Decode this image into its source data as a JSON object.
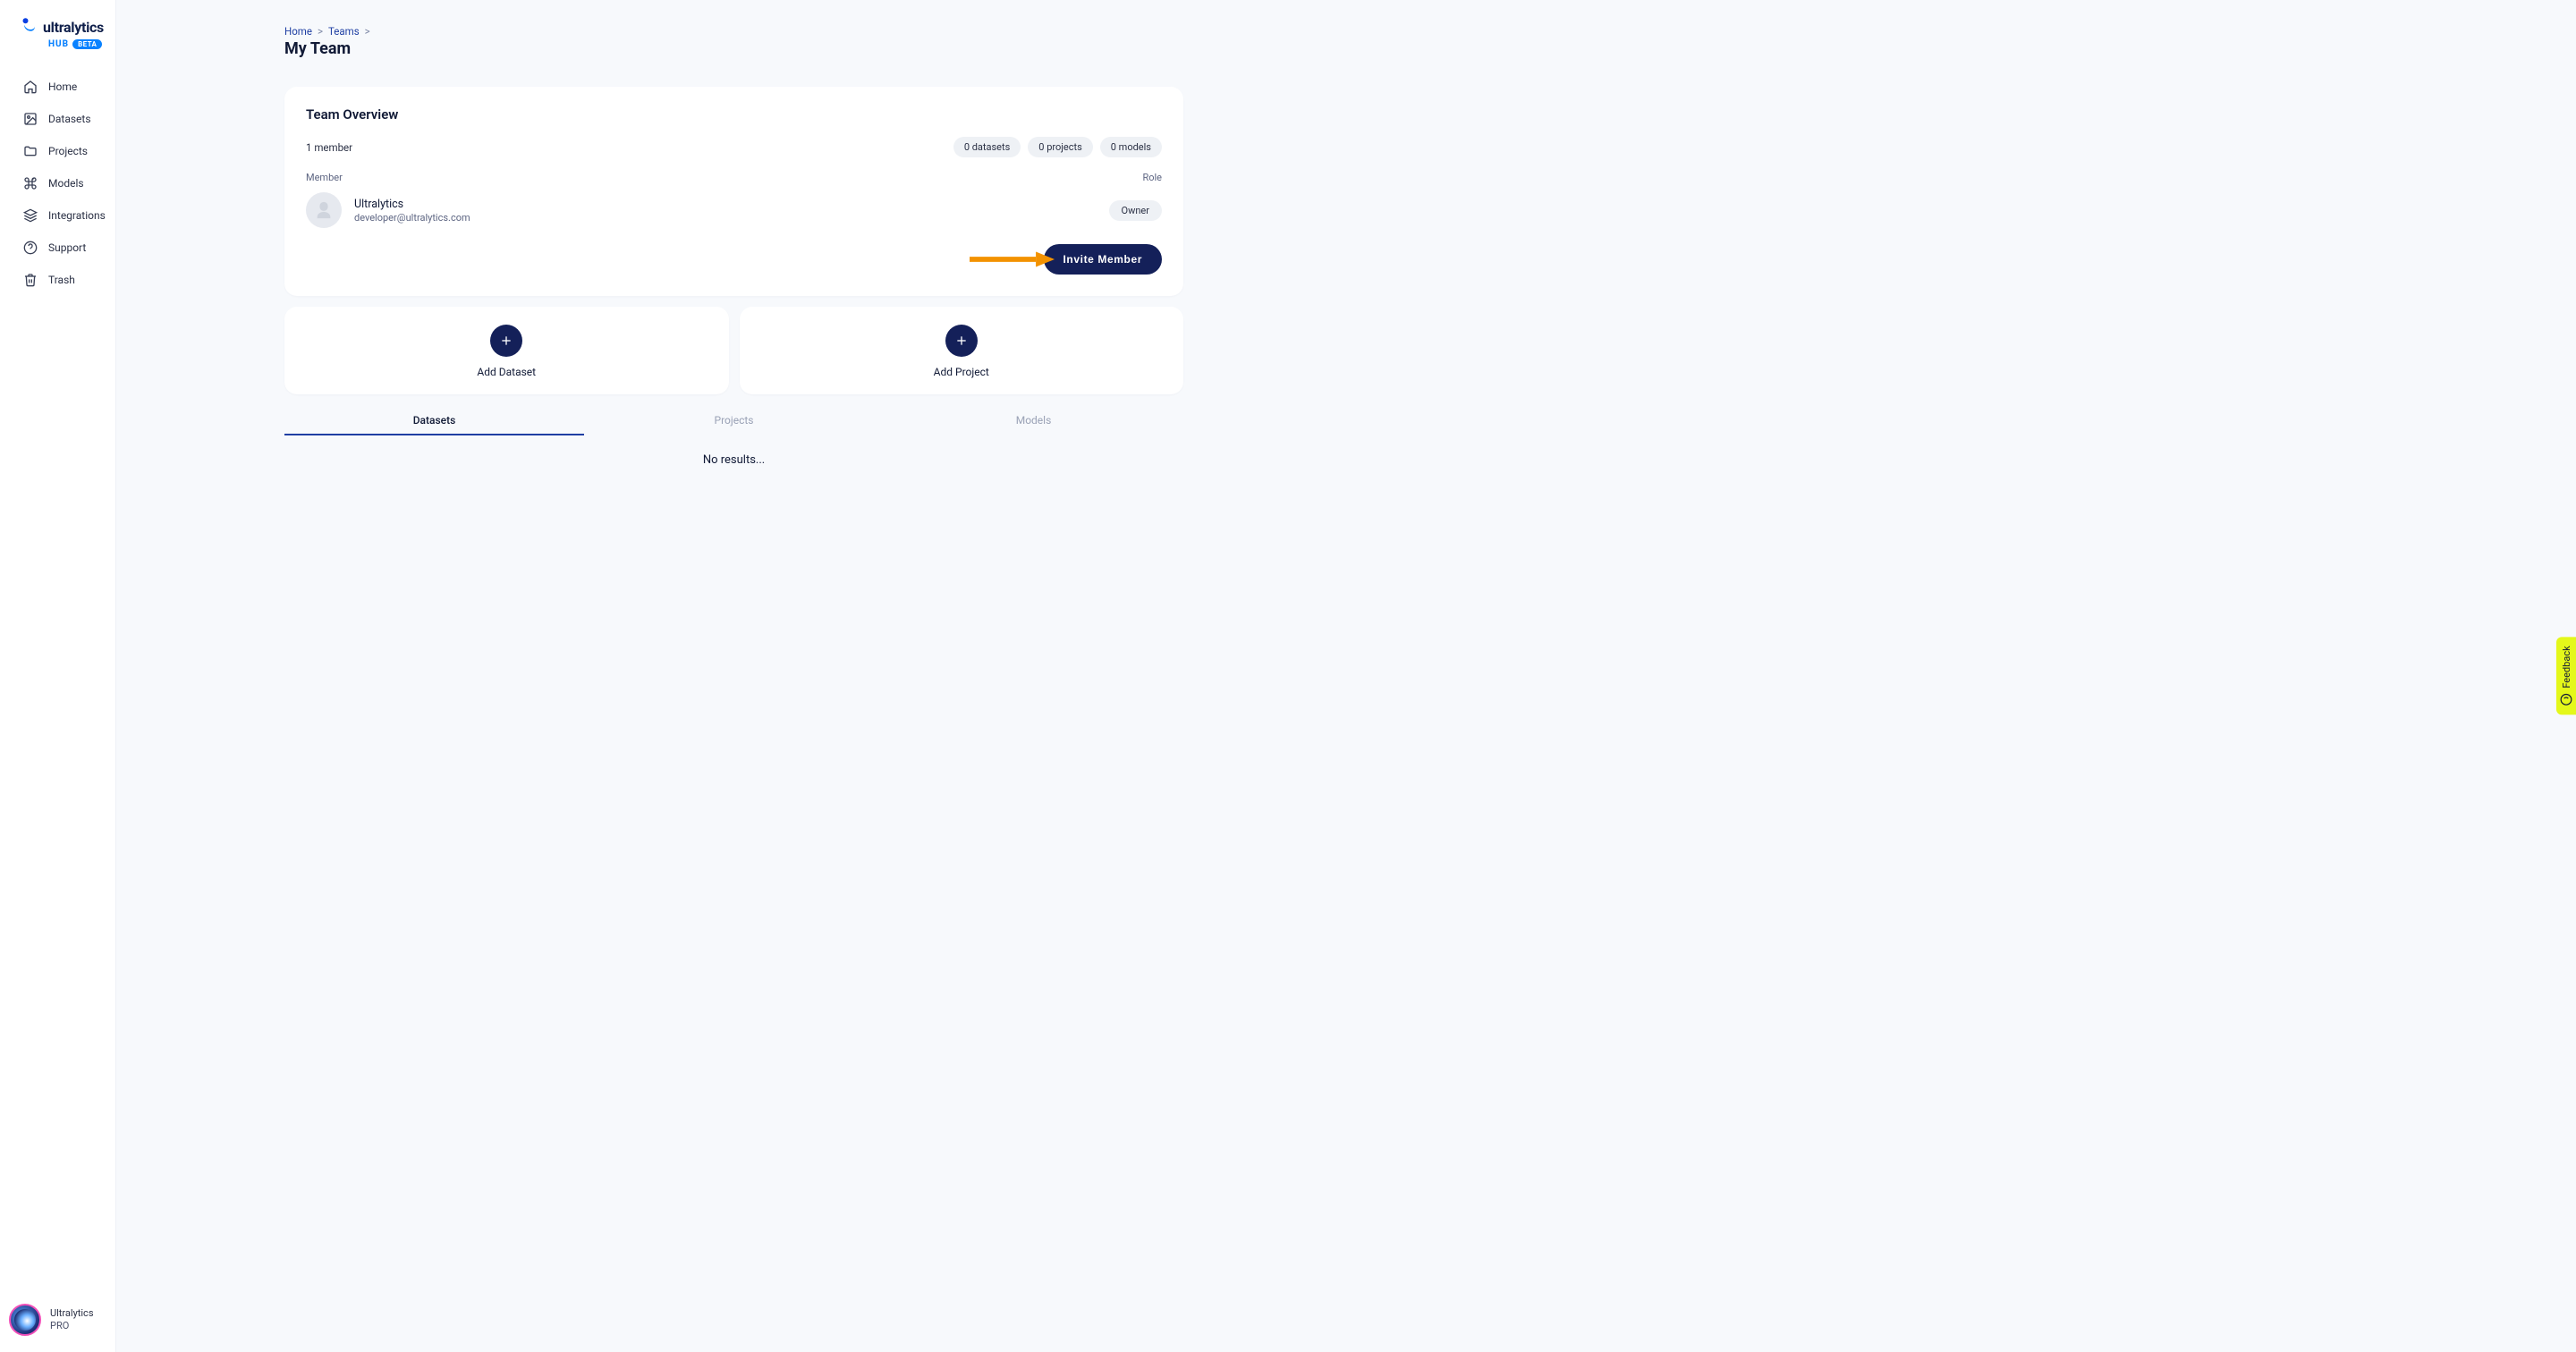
{
  "brand": {
    "name": "ultralytics",
    "sub": "HUB",
    "badge": "BETA"
  },
  "sidebar": {
    "items": [
      {
        "label": "Home",
        "icon": "home-icon"
      },
      {
        "label": "Datasets",
        "icon": "image-icon"
      },
      {
        "label": "Projects",
        "icon": "folder-icon"
      },
      {
        "label": "Models",
        "icon": "command-icon"
      },
      {
        "label": "Integrations",
        "icon": "layers-icon"
      },
      {
        "label": "Support",
        "icon": "help-icon"
      },
      {
        "label": "Trash",
        "icon": "trash-icon"
      }
    ]
  },
  "user": {
    "name": "Ultralytics",
    "plan": "PRO"
  },
  "breadcrumb": {
    "0": "Home",
    "1": "Teams",
    "sep": ">"
  },
  "page": {
    "title": "My Team"
  },
  "overview": {
    "heading": "Team Overview",
    "member_count": "1 member",
    "stats": {
      "datasets": "0 datasets",
      "projects": "0 projects",
      "models": "0 models"
    },
    "cols": {
      "member": "Member",
      "role": "Role"
    },
    "members": [
      {
        "name": "Ultralytics",
        "email": "developer@ultralytics.com",
        "role": "Owner"
      }
    ],
    "invite_label": "Invite Member"
  },
  "add_cards": {
    "dataset": "Add Dataset",
    "project": "Add Project"
  },
  "tabs": {
    "datasets": "Datasets",
    "projects": "Projects",
    "models": "Models"
  },
  "empty": {
    "no_results": "No results..."
  },
  "feedback": {
    "label": "Feedback"
  }
}
